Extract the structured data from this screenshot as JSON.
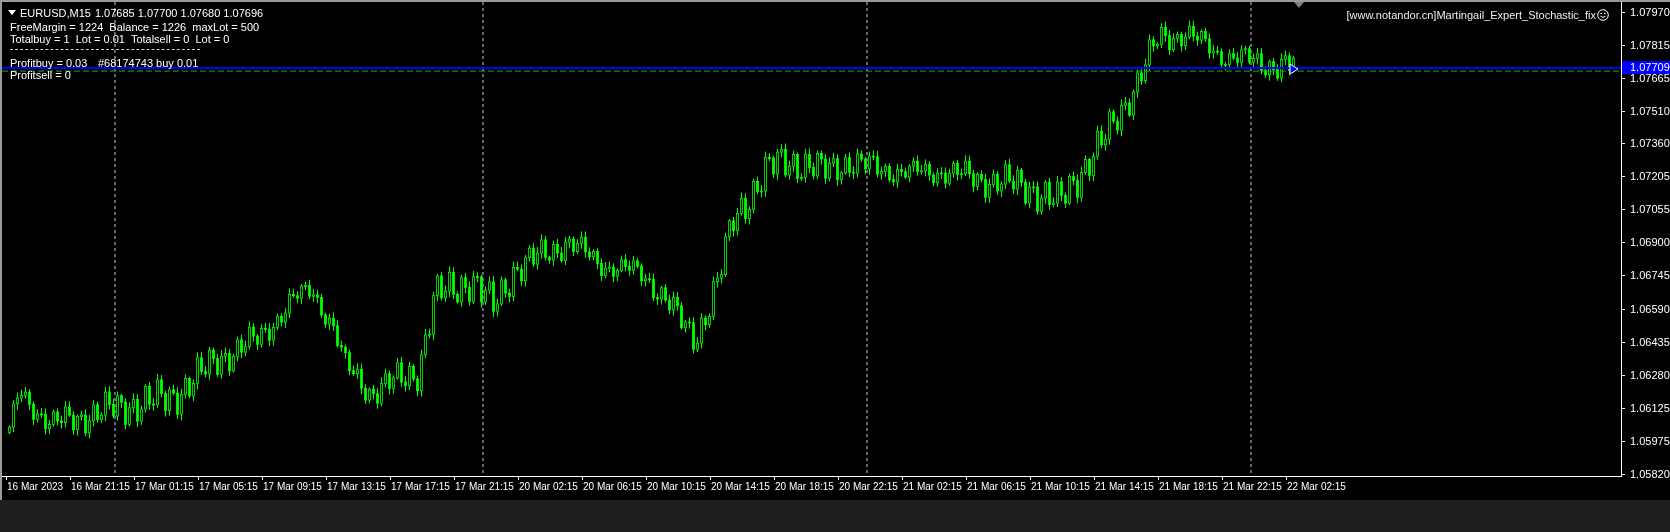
{
  "chart_header": {
    "symbol": "EURUSD,M15",
    "ohlc": "1.07685 1.07700 1.07680 1.07696"
  },
  "info_lines": [
    "FreeMargin = 1224  Balance = 1226  maxLot = 500",
    "Totalbuy = 1  Lot = 0.01  Totalsell = 0  Lot = 0",
    "Profitbuy = 0.03",
    "Profitsell = 0"
  ],
  "order_label": "#68174743 buy 0.01",
  "expert_label": "[www.notandor.cn]Martingail_Expert_Stochastic_fix",
  "price_axis": [
    {
      "label": "1.07970",
      "kind": "tick"
    },
    {
      "label": "1.07815",
      "kind": "tick"
    },
    {
      "label": "1.07709",
      "kind": "bid"
    },
    {
      "label": "1.07665",
      "kind": "tick"
    },
    {
      "label": "1.07510",
      "kind": "tick"
    },
    {
      "label": "1.07360",
      "kind": "tick"
    },
    {
      "label": "1.07205",
      "kind": "tick"
    },
    {
      "label": "1.07055",
      "kind": "tick"
    },
    {
      "label": "1.06900",
      "kind": "tick"
    },
    {
      "label": "1.06745",
      "kind": "tick"
    },
    {
      "label": "1.06590",
      "kind": "tick"
    },
    {
      "label": "1.06435",
      "kind": "tick"
    },
    {
      "label": "1.06280",
      "kind": "tick"
    },
    {
      "label": "1.06125",
      "kind": "tick"
    },
    {
      "label": "1.05975",
      "kind": "tick"
    },
    {
      "label": "1.05820",
      "kind": "tick"
    }
  ],
  "time_axis": [
    "16 Mar 2023",
    "16 Mar 21:15",
    "17 Mar 01:15",
    "17 Mar 05:15",
    "17 Mar 09:15",
    "17 Mar 13:15",
    "17 Mar 17:15",
    "17 Mar 21:15",
    "20 Mar 02:15",
    "20 Mar 06:15",
    "20 Mar 10:15",
    "20 Mar 14:15",
    "20 Mar 18:15",
    "20 Mar 22:15",
    "21 Mar 02:15",
    "21 Mar 06:15",
    "21 Mar 10:15",
    "21 Mar 14:15",
    "21 Mar 18:15",
    "21 Mar 22:15",
    "22 Mar 02:15"
  ]
}
